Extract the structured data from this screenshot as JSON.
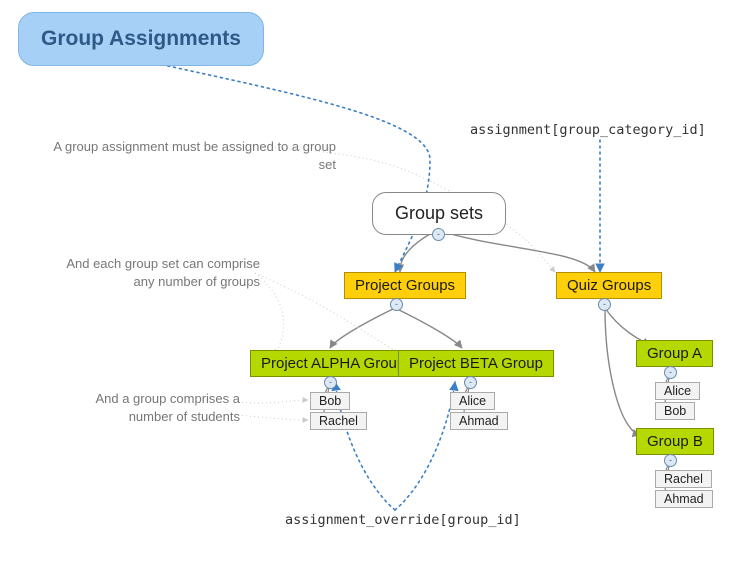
{
  "title": "Group Assignments",
  "annotations": {
    "a1": "A group assignment must be assigned to a group set",
    "a2": "And each group set can comprise\nany number of groups",
    "a3": "And a group comprises a\nnumber of students"
  },
  "api_labels": {
    "category": "assignment[group_category_id]",
    "override": "assignment_override[group_id]"
  },
  "root": {
    "label": "Group sets"
  },
  "group_sets": [
    {
      "name": "Project Groups",
      "groups": [
        {
          "name": "Project ALPHA Group",
          "students": [
            "Bob",
            "Rachel"
          ]
        },
        {
          "name": "Project BETA Group",
          "students": [
            "Alice",
            "Ahmad"
          ]
        }
      ]
    },
    {
      "name": "Quiz Groups",
      "groups": [
        {
          "name": "Group A",
          "students": [
            "Alice",
            "Bob"
          ]
        },
        {
          "name": "Group B",
          "students": [
            "Rachel",
            "Ahmad"
          ]
        }
      ]
    }
  ],
  "colors": {
    "title_bg": "#a6d0f6",
    "groupset_bg": "#ffd00a",
    "group_bg": "#b5d900",
    "dotted_link": "#3b7fc4",
    "solid_link": "#888888",
    "faint_link": "#cccccc"
  }
}
